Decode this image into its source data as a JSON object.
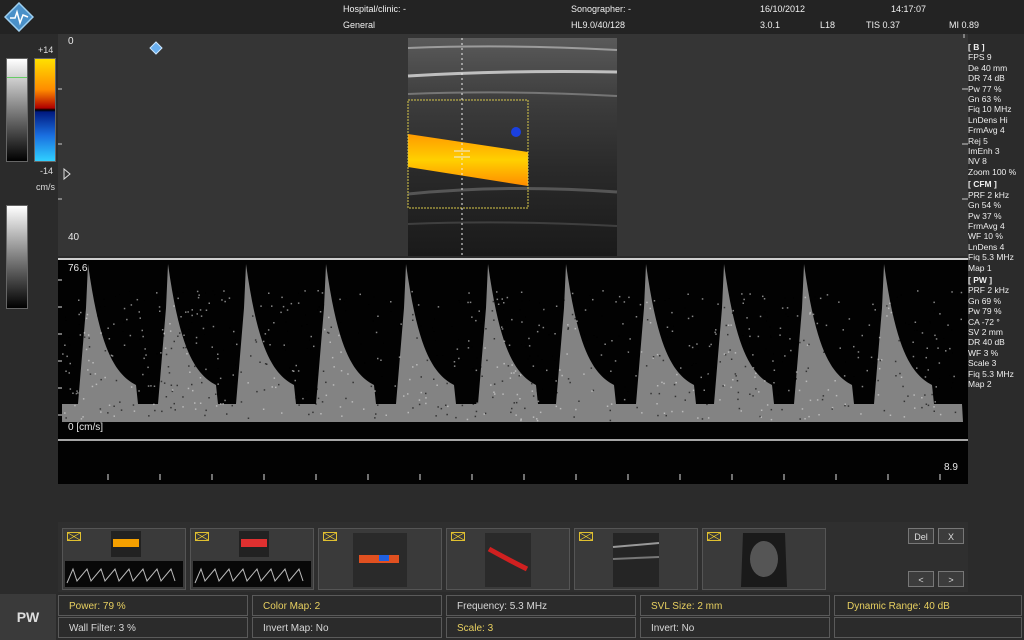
{
  "header": {
    "hospital_label": "Hospital/clinic: -",
    "preset": "General",
    "sonographer_label": "Sonographer: -",
    "probe_info": "HL9.0/40/128",
    "date": "16/10/2012",
    "time": "14:17:07",
    "version": "3.0.1",
    "code": "L18",
    "tis": "TIS 0.37",
    "mi": "MI 0.89"
  },
  "left_bars": {
    "color_top": "+14",
    "color_bottom": "-14",
    "unit": "cm/s"
  },
  "bmode": {
    "depth_top": "0",
    "depth_bottom": "40"
  },
  "doppler": {
    "scale_top": "76.6",
    "baseline": "0 [cm/s]",
    "time_value": "8.9"
  },
  "params": {
    "b_header": "[ B ]",
    "b": [
      "FPS 9",
      "De 40 mm",
      "DR 74 dB",
      "Pw 77 %",
      "Gn 63 %",
      "Fiq 10 MHz",
      "LnDens Hi",
      "FrmAvg 4",
      "Rej 5",
      "ImEnh 3",
      "NV 8",
      "Zoom 100 %"
    ],
    "cfm_header": "[ CFM ]",
    "cfm": [
      "PRF 2 kHz",
      "Gn 54 %",
      "Pw 37 %",
      "FrmAvg 4",
      "WF 10 %",
      "LnDens 4",
      "Fiq 5.3 MHz",
      "Map 1"
    ],
    "pw_header": "[ PW ]",
    "pw": [
      "PRF 2 kHz",
      "Gn 69 %",
      "Pw 79 %",
      "CA -72 °",
      "SV 2 mm",
      "DR 40 dB",
      "WF 3 %",
      "Scale 3",
      "Fiq 5.3 MHz",
      "Map 2"
    ]
  },
  "thumbnails": {
    "del_label": "Del",
    "close_label": "X",
    "prev_label": "<",
    "next_label": ">"
  },
  "bottom": {
    "mode": "PW",
    "power": "Power: 79 %",
    "color_map": "Color Map: 2",
    "frequency": "Frequency: 5.3 MHz",
    "svl_size": "SVL Size: 2 mm",
    "dynamic_range": "Dynamic Range: 40 dB",
    "wall_filter": "Wall Filter: 3 %",
    "invert_map": "Invert Map: No",
    "scale": "Scale: 3",
    "invert": "Invert: No"
  },
  "colors": {
    "accent_yellow": "#e8d060",
    "flow_orange": "#f5a000",
    "flow_blue": "#1a6fe0",
    "roi_box": "#d8c84a"
  }
}
